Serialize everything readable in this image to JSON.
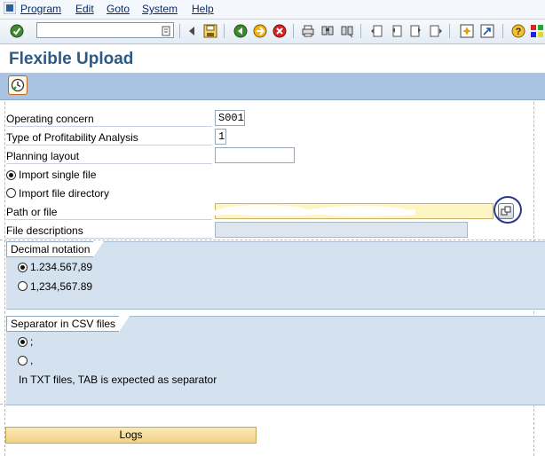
{
  "menu": {
    "items": [
      "Program",
      "Edit",
      "Goto",
      "System",
      "Help"
    ]
  },
  "toolbar": {
    "command_field_value": "",
    "icons": [
      "check-icon",
      "save-icon",
      "back-icon",
      "exit-icon",
      "cancel-icon",
      "print-icon",
      "find-icon",
      "find-next-icon",
      "first-page-icon",
      "previous-page-icon",
      "next-page-icon",
      "last-page-icon",
      "create-session-icon",
      "shortcut-icon",
      "help-icon",
      "layout-icon"
    ]
  },
  "page": {
    "title": "Flexible Upload"
  },
  "form": {
    "operating_concern_label": "Operating concern",
    "operating_concern_value": "S001",
    "profitability_type_label": "Type of Profitability Analysis",
    "profitability_type_value": "1",
    "planning_layout_label": "Planning layout",
    "planning_layout_value": "",
    "import_single_label": "Import single file",
    "import_directory_label": "Import file directory",
    "import_mode_selected": "single",
    "path_label": "Path or file",
    "path_value": "",
    "file_descriptions_label": "File descriptions",
    "file_descriptions_value": ""
  },
  "decimal_group": {
    "title": "Decimal notation",
    "options": [
      "1.234.567,89",
      "1,234,567.89"
    ],
    "selected_index": 0
  },
  "separator_group": {
    "title": "Separator in CSV files",
    "options": [
      ";",
      ","
    ],
    "selected_index": 0,
    "note": "In TXT files, TAB is expected as separator"
  },
  "logs_button": {
    "label": "Logs"
  },
  "colors": {
    "title": "#2c5a86",
    "app_toolbar": "#a9c4e2",
    "group_background": "#d4e2f0",
    "required_field": "#fff4c4",
    "button_background": "#f5dc9a"
  }
}
